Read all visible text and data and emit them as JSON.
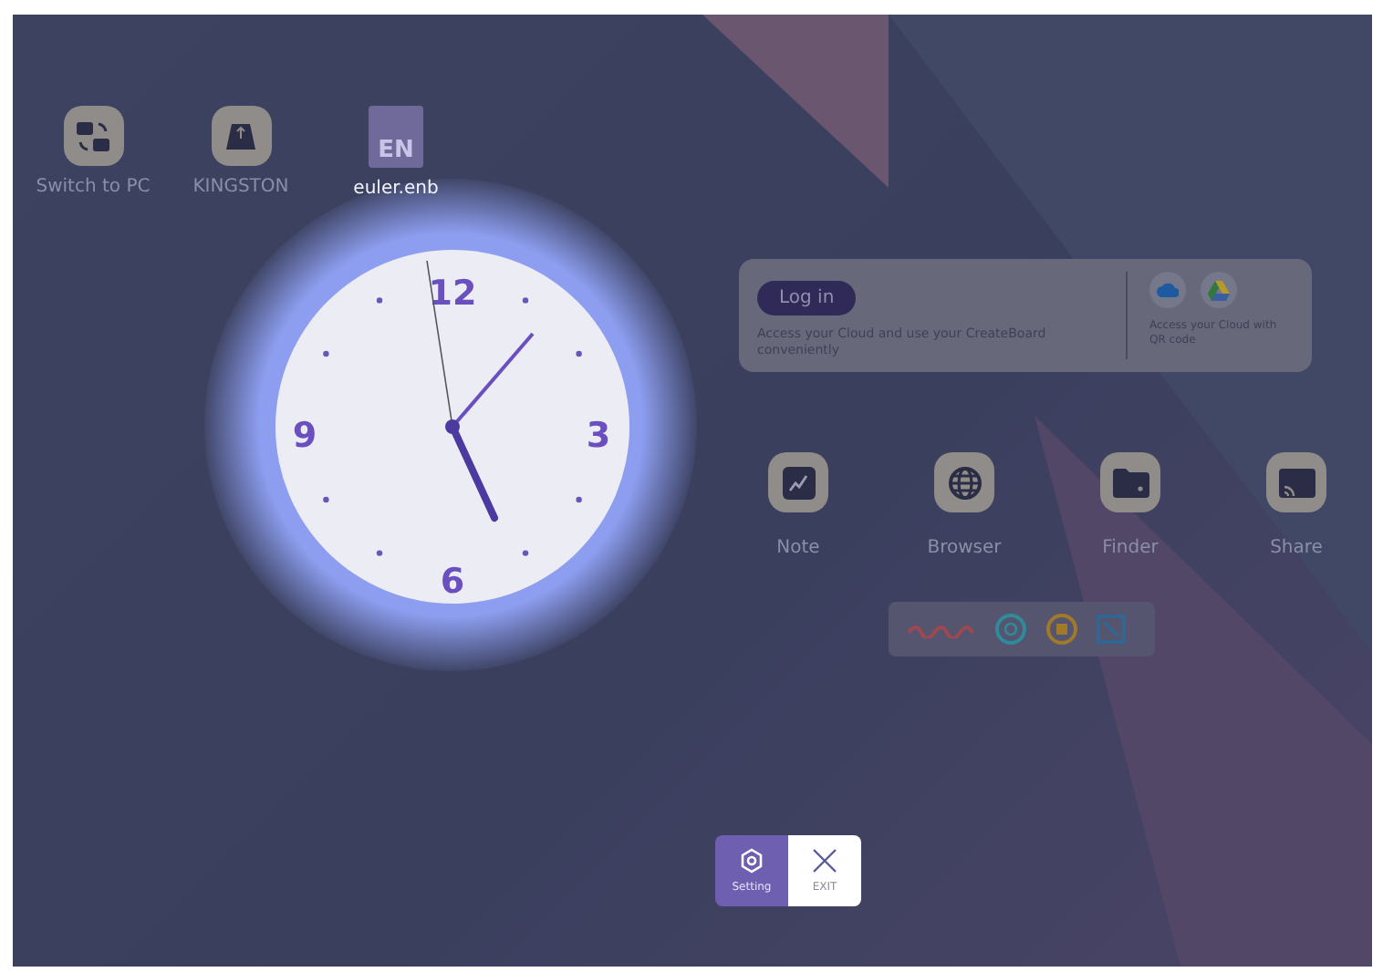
{
  "desktop_icons": [
    {
      "label": "Switch to PC",
      "kind": "switch"
    },
    {
      "label": "KINGSTON",
      "kind": "usb"
    },
    {
      "label": "euler.enb",
      "kind": "file",
      "badge": "EN"
    }
  ],
  "clock": {
    "numerals": [
      "12",
      "3",
      "6",
      "9"
    ]
  },
  "cloud_card": {
    "login_button": "Log in",
    "description": "Access your Cloud and use your CreateBoard conveniently",
    "qr_text": "Access your Cloud with QR code"
  },
  "apps": [
    {
      "label": "Note",
      "kind": "note"
    },
    {
      "label": "Browser",
      "kind": "browser"
    },
    {
      "label": "Finder",
      "kind": "finder"
    },
    {
      "label": "Share",
      "kind": "share"
    }
  ],
  "bottom_buttons": [
    {
      "label": "Setting",
      "kind": "setting",
      "selected": true
    },
    {
      "label": "EXIT",
      "kind": "exit",
      "selected": false
    }
  ]
}
